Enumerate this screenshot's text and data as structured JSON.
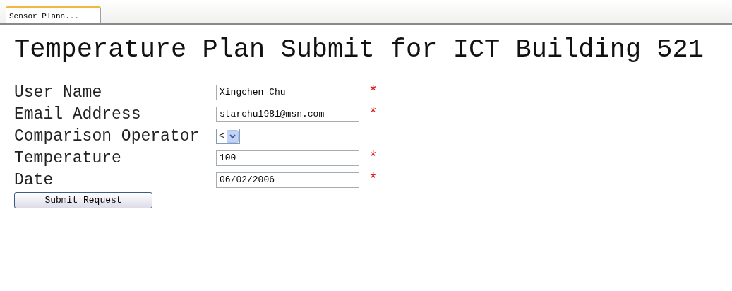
{
  "tab": {
    "label": "Sensor Plann...",
    "selected": true
  },
  "title": "Temperature Plan Submit for ICT Building 521",
  "fields": [
    {
      "kind": "text",
      "label": "User Name",
      "value": "Xingchen Chu",
      "marker": "*"
    },
    {
      "kind": "text",
      "label": "Email Address",
      "value": "starchu1981@msn.com",
      "marker": "*"
    },
    {
      "kind": "select",
      "label": "Comparison Operator",
      "value": "<"
    },
    {
      "kind": "text",
      "label": "Temperature",
      "value": "100",
      "marker": "*"
    },
    {
      "kind": "text",
      "label": "Date",
      "value": "06/02/2006",
      "marker": "*"
    }
  ],
  "submit": "Submit Request"
}
